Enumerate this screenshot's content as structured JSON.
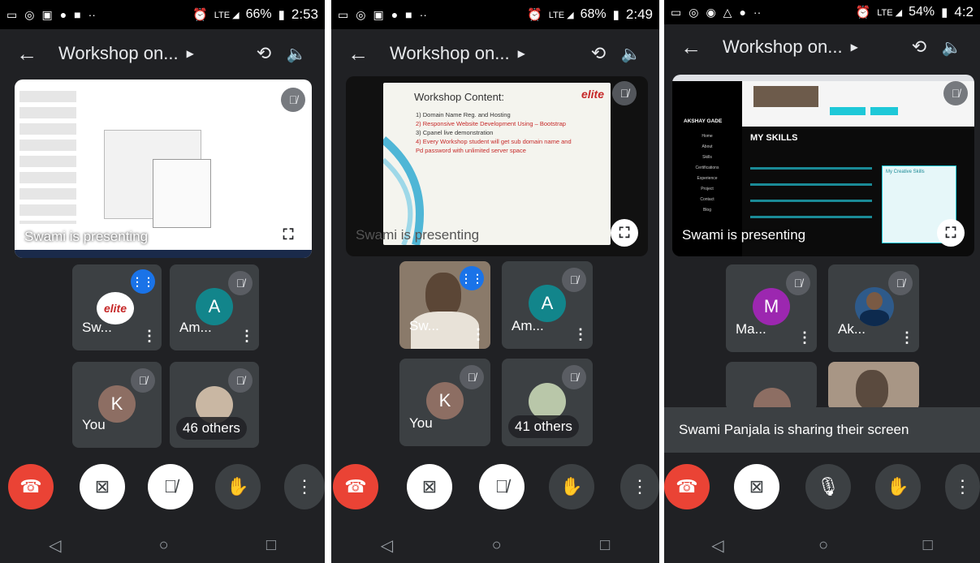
{
  "meeting_title": "Workshop on...",
  "presenting_text": "Swami is presenting",
  "panels": [
    {
      "status": {
        "battery": "66%",
        "time": "2:53"
      },
      "tiles": [
        {
          "name": "Sw...",
          "kind": "logo"
        },
        {
          "name": "Am...",
          "initial": "A",
          "color": "#12858b"
        },
        {
          "name": "You",
          "initial": "K",
          "color": "#8d6e63"
        },
        {
          "others": "46 others"
        }
      ]
    },
    {
      "status": {
        "battery": "68%",
        "time": "2:49"
      },
      "slide": {
        "title": "Workshop Content:",
        "items": [
          "1) Domain Name Reg. and Hosting",
          "2) Responsive Website Development Using – Bootstrap",
          "3) Cpanel live demonstration",
          "4) Every Workshop student will get sub domain name and",
          "Pd password with unlimited server space"
        ],
        "logo": "elite"
      },
      "tiles": [
        {
          "name": "Sw...",
          "kind": "video"
        },
        {
          "name": "Am...",
          "initial": "A",
          "color": "#12858b"
        },
        {
          "name": "You",
          "initial": "K",
          "color": "#8d6e63"
        },
        {
          "others": "41 others"
        }
      ]
    },
    {
      "status": {
        "battery": "54%",
        "time": "4:2"
      },
      "site": {
        "name": "AKSHAY GADE",
        "menu": [
          "Home",
          "About",
          "Skills",
          "Certifications",
          "Experience",
          "Project",
          "Contact",
          "Blog"
        ],
        "heading": "MY SKILLS",
        "card_title": "My Creative Skills"
      },
      "tiles": [
        {
          "name": "Ma...",
          "initial": "M",
          "color": "#9c27b0"
        },
        {
          "name": "Ak...",
          "kind": "photo"
        }
      ],
      "toast": "Swami Panjala is sharing their screen"
    }
  ],
  "icons": {
    "end_call": "phone-hangup-icon",
    "camera_off": "camera-off-icon",
    "mic_off": "mic-off-icon",
    "mic": "mic-icon",
    "hand": "raise-hand-icon",
    "more": "more-vert-icon"
  }
}
